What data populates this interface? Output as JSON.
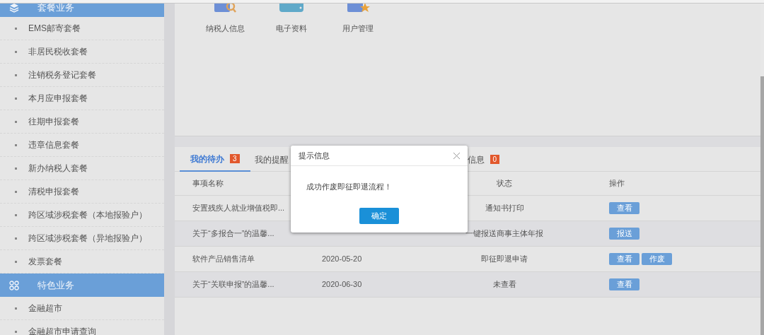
{
  "sidebar": {
    "groups": [
      {
        "label": "套餐业务",
        "kind": "layers",
        "items": [
          "EMS邮寄套餐",
          "非居民税收套餐",
          "注销税务登记套餐",
          "本月应申报套餐",
          "往期申报套餐",
          "违章信息套餐",
          "新办纳税人套餐",
          "清税申报套餐",
          "跨区域涉税套餐（本地报验户）",
          "跨区域涉税套餐（异地报验户）",
          "发票套餐"
        ]
      },
      {
        "label": "特色业务",
        "kind": "grid",
        "items": [
          "金融超市",
          "金融超市申请查询"
        ]
      }
    ]
  },
  "shortcuts": [
    {
      "label": "纳税人信息",
      "kind": "card-search"
    },
    {
      "label": "电子资料",
      "kind": "device"
    },
    {
      "label": "用户管理",
      "kind": "card-star"
    }
  ],
  "tabs": [
    {
      "label": "我的待办",
      "count": "3",
      "selected": true
    },
    {
      "label": "我的提醒",
      "selected": false
    },
    {
      "label": "信息",
      "count": "0",
      "selected": false
    }
  ],
  "table": {
    "columns": {
      "name": "事项名称",
      "status": "状态",
      "actions": "操作"
    },
    "rows": [
      {
        "name": "安置残疾人就业增值税即...",
        "status": "通知书打印",
        "actions": [
          "查看"
        ]
      },
      {
        "name": "关于“多报合一”的温馨...",
        "status": "一键报送商事主体年报",
        "actions": [
          "报送"
        ]
      },
      {
        "name": "软件产品销售清单",
        "date": "2020-05-20",
        "status": "即征即退申请",
        "actions": [
          "查看",
          "作废"
        ]
      },
      {
        "name": "关于“关联申报”的温馨...",
        "date": "2020-06-30",
        "status": "未查看",
        "actions": [
          "查看"
        ]
      }
    ]
  },
  "dialog": {
    "title": "提示信息",
    "message": "成功作废即征即退流程！",
    "button": "确定"
  }
}
